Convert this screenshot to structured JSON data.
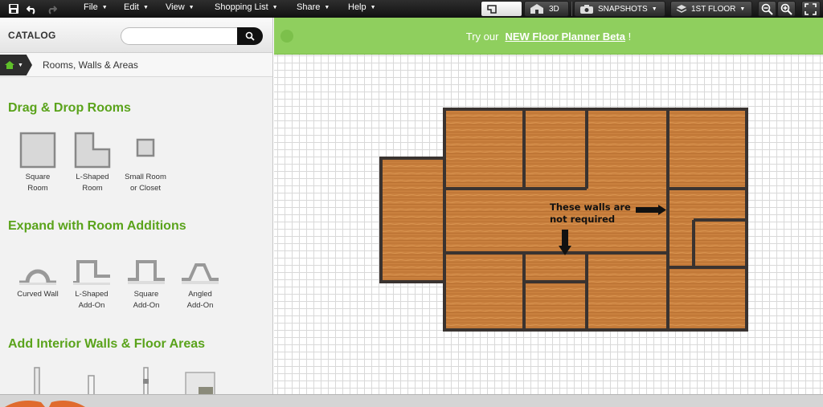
{
  "toolbar": {
    "menus": [
      "File",
      "Edit",
      "View",
      "Shopping List",
      "Share",
      "Help"
    ],
    "view_3d_label": "3D",
    "snapshots_label": "SNAPSHOTS",
    "floor_label": "1ST FLOOR",
    "icons": [
      "save-icon",
      "undo-icon",
      "redo-icon",
      "2d-plan-icon",
      "house-3d-icon",
      "camera-icon",
      "layers-icon",
      "zoom-out-icon",
      "zoom-in-icon",
      "fullscreen-icon"
    ]
  },
  "catalog": {
    "title": "CATALOG",
    "search_value": "",
    "breadcrumb": "Rooms, Walls & Areas",
    "sections": [
      {
        "title": "Drag & Drop Rooms",
        "items": [
          {
            "line1": "Square",
            "line2": "Room",
            "icon": "square-room-icon"
          },
          {
            "line1": "L-Shaped",
            "line2": "Room",
            "icon": "l-shaped-room-icon"
          },
          {
            "line1": "Small Room",
            "line2": "or Closet",
            "icon": "small-room-icon"
          }
        ]
      },
      {
        "title": "Expand with Room Additions",
        "items": [
          {
            "line1": "Curved Wall",
            "line2": "",
            "icon": "curved-wall-icon"
          },
          {
            "line1": "L-Shaped",
            "line2": "Add-On",
            "icon": "l-shaped-addon-icon"
          },
          {
            "line1": "Square",
            "line2": "Add-On",
            "icon": "square-addon-icon"
          },
          {
            "line1": "Angled",
            "line2": "Add-On",
            "icon": "angled-addon-icon"
          }
        ]
      },
      {
        "title": "Add Interior Walls & Floor Areas",
        "items": [
          {
            "icon": "interior-wall-icon"
          },
          {
            "icon": "short-wall-icon"
          },
          {
            "icon": "wall-segment-icon"
          },
          {
            "icon": "floor-area-icon"
          }
        ]
      }
    ]
  },
  "banner": {
    "text": "Try our",
    "link": "NEW Floor Planner Beta",
    "suffix": "!"
  },
  "annotation": {
    "line1": "These walls are",
    "line2": "not required"
  },
  "colors": {
    "accent_green": "#5aa31b",
    "banner_green": "#8fcf5e",
    "floor_wood": "#c9803e",
    "wall": "#3a3330"
  }
}
